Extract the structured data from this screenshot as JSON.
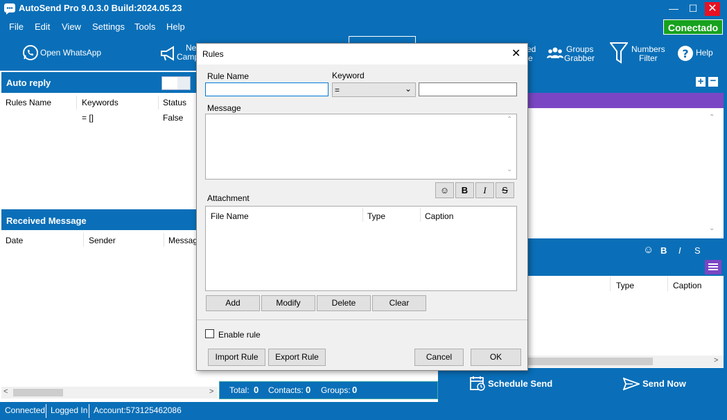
{
  "window": {
    "title": "AutoSend Pro 9.0.3.0 Build:2024.05.23",
    "min_icon": "minimize-icon",
    "max_icon": "maximize-icon",
    "close_icon": "close-icon"
  },
  "menu": [
    "File",
    "Edit",
    "View",
    "Settings",
    "Tools",
    "Help"
  ],
  "connection_status": "Conectado",
  "toolbar": {
    "open_whatsapp": "Open WhatsApp",
    "new_campaign_line1": "Ne",
    "new_campaign_line2": "Camp",
    "partial_right_line1": "ed",
    "partial_right_line2": "e",
    "groups_grabber_line1": "Groups",
    "groups_grabber_line2": "Grabber",
    "numbers_filter_line1": "Numbers",
    "numbers_filter_line2": "Filter",
    "help": "Help"
  },
  "auto_reply": {
    "title": "Auto reply",
    "columns": [
      "Rules Name",
      "Keywords",
      "Status"
    ],
    "rows": [
      {
        "name": "",
        "keywords": "= []",
        "status": "False"
      }
    ]
  },
  "received": {
    "title": "Received Message",
    "columns": [
      "Date",
      "Sender",
      "Message"
    ]
  },
  "right_panel": {
    "attachment_columns": [
      "Type",
      "Caption"
    ],
    "format_bold": "B",
    "format_italic": "I",
    "format_strike": "S",
    "schedule_send": "Schedule Send",
    "send_now": "Send Now"
  },
  "totals": {
    "total_label": "Total:",
    "total_value": "0",
    "contacts_label": "Contacts:",
    "contacts_value": "0",
    "groups_label": "Groups:",
    "groups_value": "0"
  },
  "dialog": {
    "title": "Rules",
    "rule_name_label": "Rule Name",
    "rule_name_value": "",
    "keyword_label": "Keyword",
    "keyword_operator": "=",
    "keyword_value": "",
    "message_label": "Message",
    "message_value": "",
    "format_bold": "B",
    "format_italic": "I",
    "format_strike": "S",
    "attachment_label": "Attachment",
    "attachment_columns": [
      "File Name",
      "Type",
      "Caption"
    ],
    "add": "Add",
    "modify": "Modify",
    "delete": "Delete",
    "clear": "Clear",
    "enable_rule": "Enable rule",
    "import_rule": "Import Rule",
    "export_rule": "Export Rule",
    "cancel": "Cancel",
    "ok": "OK"
  },
  "statusbar": {
    "connected": "Connected",
    "logged_in": "Logged In",
    "account": "Account:573125462086"
  },
  "colors": {
    "brand_blue": "#0a6fb8",
    "status_green": "#17a21e",
    "accent_purple": "#7b46c4",
    "close_red": "#e81123"
  }
}
